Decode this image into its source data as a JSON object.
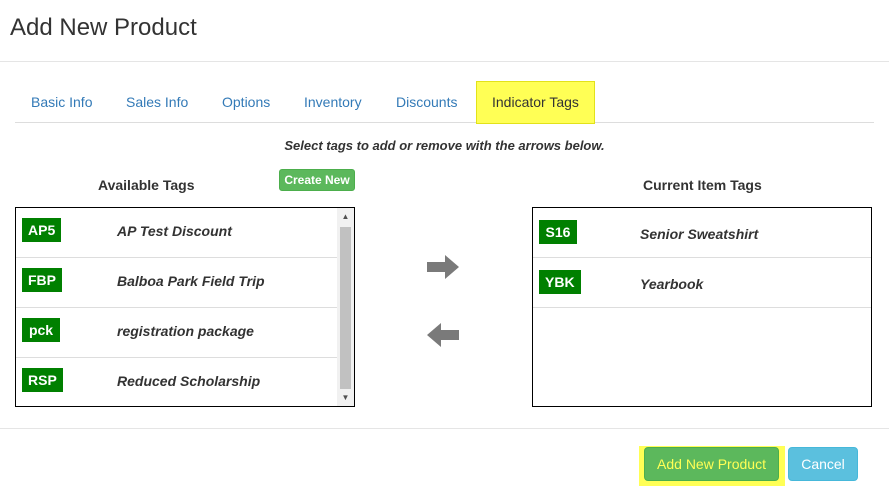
{
  "modal": {
    "title": "Add New Product"
  },
  "tabs": [
    {
      "label": "Basic Info"
    },
    {
      "label": "Sales Info"
    },
    {
      "label": "Options"
    },
    {
      "label": "Inventory"
    },
    {
      "label": "Discounts"
    },
    {
      "label": "Indicator Tags",
      "active": true
    }
  ],
  "instruction": "Select tags to add or remove with the arrows below.",
  "available": {
    "title": "Available Tags",
    "create_label": "Create New",
    "tags": [
      {
        "code": "AP5",
        "name": "AP Test Discount"
      },
      {
        "code": "FBP",
        "name": "Balboa Park Field Trip"
      },
      {
        "code": "pck",
        "name": "registration package"
      },
      {
        "code": "RSP",
        "name": "Reduced Scholarship"
      }
    ]
  },
  "current": {
    "title": "Current Item Tags",
    "tags": [
      {
        "code": "S16",
        "name": "Senior Sweatshirt"
      },
      {
        "code": "YBK",
        "name": "Yearbook"
      }
    ]
  },
  "icons": {
    "add": "arrow-right-icon",
    "remove": "arrow-left-icon",
    "scroll_up": "scroll-up-icon",
    "scroll_down": "scroll-down-icon"
  },
  "footer": {
    "add_label": "Add New Product",
    "cancel_label": "Cancel"
  },
  "colors": {
    "tag_badge": "#008000",
    "highlight": "#ffff55",
    "link": "#337ab7",
    "success": "#5cb85c",
    "info": "#5bc0de"
  }
}
